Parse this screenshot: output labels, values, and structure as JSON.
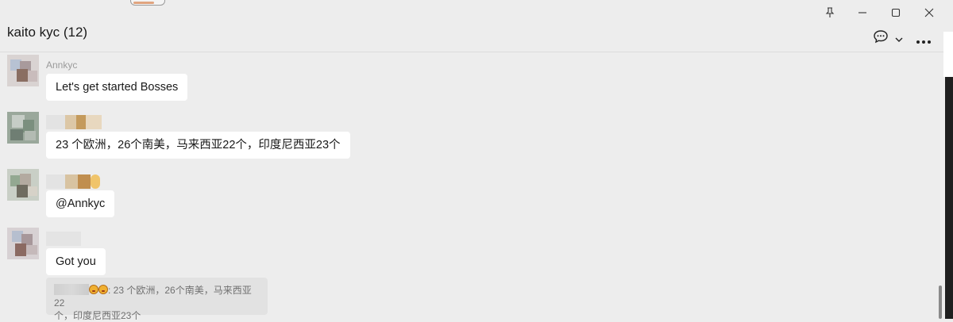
{
  "window": {
    "title": "kaito kyc (12)",
    "controls": [
      "pin-icon",
      "minimize-icon",
      "maximize-icon",
      "close-icon"
    ]
  },
  "header": {
    "chat_icon": "chat-bubble-icon",
    "dropdown_icon": "chevron-down-icon",
    "more_icon": "more-icon"
  },
  "messages": [
    {
      "sender": "Annkyc",
      "text": "Let's get started Bosses"
    },
    {
      "sender": "",
      "text": "23 个欧洲，26个南美，马来西亚22个，印度尼西亚23个"
    },
    {
      "sender": "",
      "text": "@Annkyc"
    },
    {
      "sender": "",
      "text": "Got you"
    }
  ],
  "quote": {
    "line1": ": 23 个欧洲，26个南美，马来西亚22",
    "line2": "个，印度尼西亚23个"
  },
  "colors": {
    "background": "#ededed",
    "bubble": "#ffffff",
    "quote_bg": "#e2e2e2"
  }
}
